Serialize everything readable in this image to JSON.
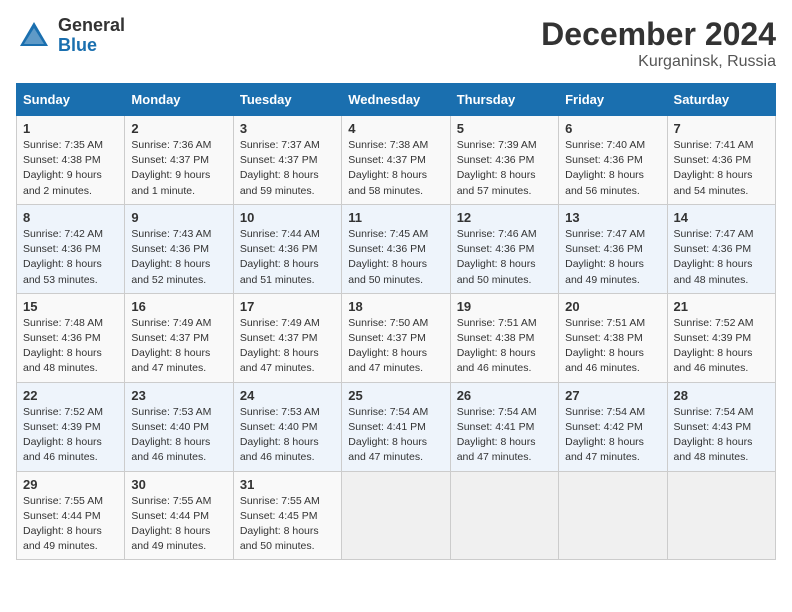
{
  "header": {
    "logo_general": "General",
    "logo_blue": "Blue",
    "month": "December 2024",
    "location": "Kurganinsk, Russia"
  },
  "days_of_week": [
    "Sunday",
    "Monday",
    "Tuesday",
    "Wednesday",
    "Thursday",
    "Friday",
    "Saturday"
  ],
  "weeks": [
    [
      {
        "day": 1,
        "sunrise": "7:35 AM",
        "sunset": "4:38 PM",
        "daylight": "9 hours and 2 minutes."
      },
      {
        "day": 2,
        "sunrise": "7:36 AM",
        "sunset": "4:37 PM",
        "daylight": "9 hours and 1 minute."
      },
      {
        "day": 3,
        "sunrise": "7:37 AM",
        "sunset": "4:37 PM",
        "daylight": "8 hours and 59 minutes."
      },
      {
        "day": 4,
        "sunrise": "7:38 AM",
        "sunset": "4:37 PM",
        "daylight": "8 hours and 58 minutes."
      },
      {
        "day": 5,
        "sunrise": "7:39 AM",
        "sunset": "4:36 PM",
        "daylight": "8 hours and 57 minutes."
      },
      {
        "day": 6,
        "sunrise": "7:40 AM",
        "sunset": "4:36 PM",
        "daylight": "8 hours and 56 minutes."
      },
      {
        "day": 7,
        "sunrise": "7:41 AM",
        "sunset": "4:36 PM",
        "daylight": "8 hours and 54 minutes."
      }
    ],
    [
      {
        "day": 8,
        "sunrise": "7:42 AM",
        "sunset": "4:36 PM",
        "daylight": "8 hours and 53 minutes."
      },
      {
        "day": 9,
        "sunrise": "7:43 AM",
        "sunset": "4:36 PM",
        "daylight": "8 hours and 52 minutes."
      },
      {
        "day": 10,
        "sunrise": "7:44 AM",
        "sunset": "4:36 PM",
        "daylight": "8 hours and 51 minutes."
      },
      {
        "day": 11,
        "sunrise": "7:45 AM",
        "sunset": "4:36 PM",
        "daylight": "8 hours and 50 minutes."
      },
      {
        "day": 12,
        "sunrise": "7:46 AM",
        "sunset": "4:36 PM",
        "daylight": "8 hours and 50 minutes."
      },
      {
        "day": 13,
        "sunrise": "7:47 AM",
        "sunset": "4:36 PM",
        "daylight": "8 hours and 49 minutes."
      },
      {
        "day": 14,
        "sunrise": "7:47 AM",
        "sunset": "4:36 PM",
        "daylight": "8 hours and 48 minutes."
      }
    ],
    [
      {
        "day": 15,
        "sunrise": "7:48 AM",
        "sunset": "4:36 PM",
        "daylight": "8 hours and 48 minutes."
      },
      {
        "day": 16,
        "sunrise": "7:49 AM",
        "sunset": "4:37 PM",
        "daylight": "8 hours and 47 minutes."
      },
      {
        "day": 17,
        "sunrise": "7:49 AM",
        "sunset": "4:37 PM",
        "daylight": "8 hours and 47 minutes."
      },
      {
        "day": 18,
        "sunrise": "7:50 AM",
        "sunset": "4:37 PM",
        "daylight": "8 hours and 47 minutes."
      },
      {
        "day": 19,
        "sunrise": "7:51 AM",
        "sunset": "4:38 PM",
        "daylight": "8 hours and 46 minutes."
      },
      {
        "day": 20,
        "sunrise": "7:51 AM",
        "sunset": "4:38 PM",
        "daylight": "8 hours and 46 minutes."
      },
      {
        "day": 21,
        "sunrise": "7:52 AM",
        "sunset": "4:39 PM",
        "daylight": "8 hours and 46 minutes."
      }
    ],
    [
      {
        "day": 22,
        "sunrise": "7:52 AM",
        "sunset": "4:39 PM",
        "daylight": "8 hours and 46 minutes."
      },
      {
        "day": 23,
        "sunrise": "7:53 AM",
        "sunset": "4:40 PM",
        "daylight": "8 hours and 46 minutes."
      },
      {
        "day": 24,
        "sunrise": "7:53 AM",
        "sunset": "4:40 PM",
        "daylight": "8 hours and 46 minutes."
      },
      {
        "day": 25,
        "sunrise": "7:54 AM",
        "sunset": "4:41 PM",
        "daylight": "8 hours and 47 minutes."
      },
      {
        "day": 26,
        "sunrise": "7:54 AM",
        "sunset": "4:41 PM",
        "daylight": "8 hours and 47 minutes."
      },
      {
        "day": 27,
        "sunrise": "7:54 AM",
        "sunset": "4:42 PM",
        "daylight": "8 hours and 47 minutes."
      },
      {
        "day": 28,
        "sunrise": "7:54 AM",
        "sunset": "4:43 PM",
        "daylight": "8 hours and 48 minutes."
      }
    ],
    [
      {
        "day": 29,
        "sunrise": "7:55 AM",
        "sunset": "4:44 PM",
        "daylight": "8 hours and 49 minutes."
      },
      {
        "day": 30,
        "sunrise": "7:55 AM",
        "sunset": "4:44 PM",
        "daylight": "8 hours and 49 minutes."
      },
      {
        "day": 31,
        "sunrise": "7:55 AM",
        "sunset": "4:45 PM",
        "daylight": "8 hours and 50 minutes."
      },
      null,
      null,
      null,
      null
    ]
  ]
}
